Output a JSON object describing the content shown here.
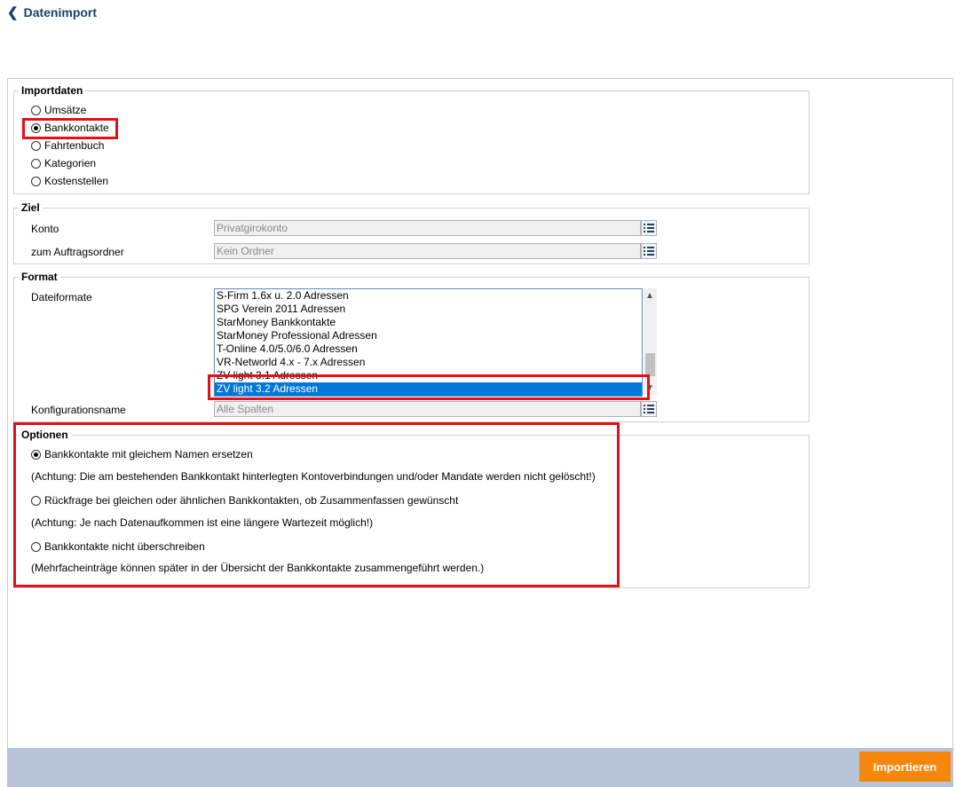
{
  "header": {
    "back_icon": "chevron-left-icon",
    "title": "Datenimport"
  },
  "importdaten": {
    "legend": "Importdaten",
    "options": [
      {
        "label": "Umsätze",
        "checked": false
      },
      {
        "label": "Bankkontakte",
        "checked": true
      },
      {
        "label": "Fahrtenbuch",
        "checked": false
      },
      {
        "label": "Kategorien",
        "checked": false
      },
      {
        "label": "Kostenstellen",
        "checked": false
      }
    ]
  },
  "ziel": {
    "legend": "Ziel",
    "konto_label": "Konto",
    "konto_placeholder": "Privatgirokonto",
    "ordner_label": "zum Auftragsordner",
    "ordner_placeholder": "Kein Ordner"
  },
  "format": {
    "legend": "Format",
    "dateiformate_label": "Dateiformate",
    "dateiformate": [
      "S-Firm 1.6x u. 2.0 Adressen",
      "SPG Verein 2011 Adressen",
      "StarMoney Bankkontakte",
      "StarMoney Professional Adressen",
      "T-Online 4.0/5.0/6.0 Adressen",
      "VR-Networld 4.x - 7.x Adressen",
      "ZV light 3.1 Adressen",
      "ZV light 3.2 Adressen"
    ],
    "selected_dateiformat": "ZV light 3.2 Adressen",
    "konfig_label": "Konfigurationsname",
    "konfig_placeholder": "Alle Spalten"
  },
  "optionen": {
    "legend": "Optionen",
    "items": [
      {
        "label": "Bankkontakte mit gleichem Namen ersetzen",
        "checked": true,
        "note": "(Achtung: Die am bestehenden Bankkontakt hinterlegten Kontoverbindungen und/oder Mandate werden nicht gelöscht!)"
      },
      {
        "label": "Rückfrage bei gleichen oder ähnlichen Bankkontakten, ob Zusammenfassen gewünscht",
        "checked": false,
        "note": "(Achtung: Je nach Datenaufkommen ist eine längere Wartezeit möglich!)"
      },
      {
        "label": "Bankkontakte nicht überschreiben",
        "checked": false,
        "note": "(Mehrfacheinträge können später in der Übersicht der Bankkontakte zusammengeführt werden.)"
      }
    ]
  },
  "footer": {
    "import_button": "Importieren"
  },
  "colors": {
    "accent": "#1d3f6e",
    "highlight": "#e21018",
    "button": "#f7860c",
    "footer": "#b7c4d7",
    "selection": "#0078d7"
  }
}
